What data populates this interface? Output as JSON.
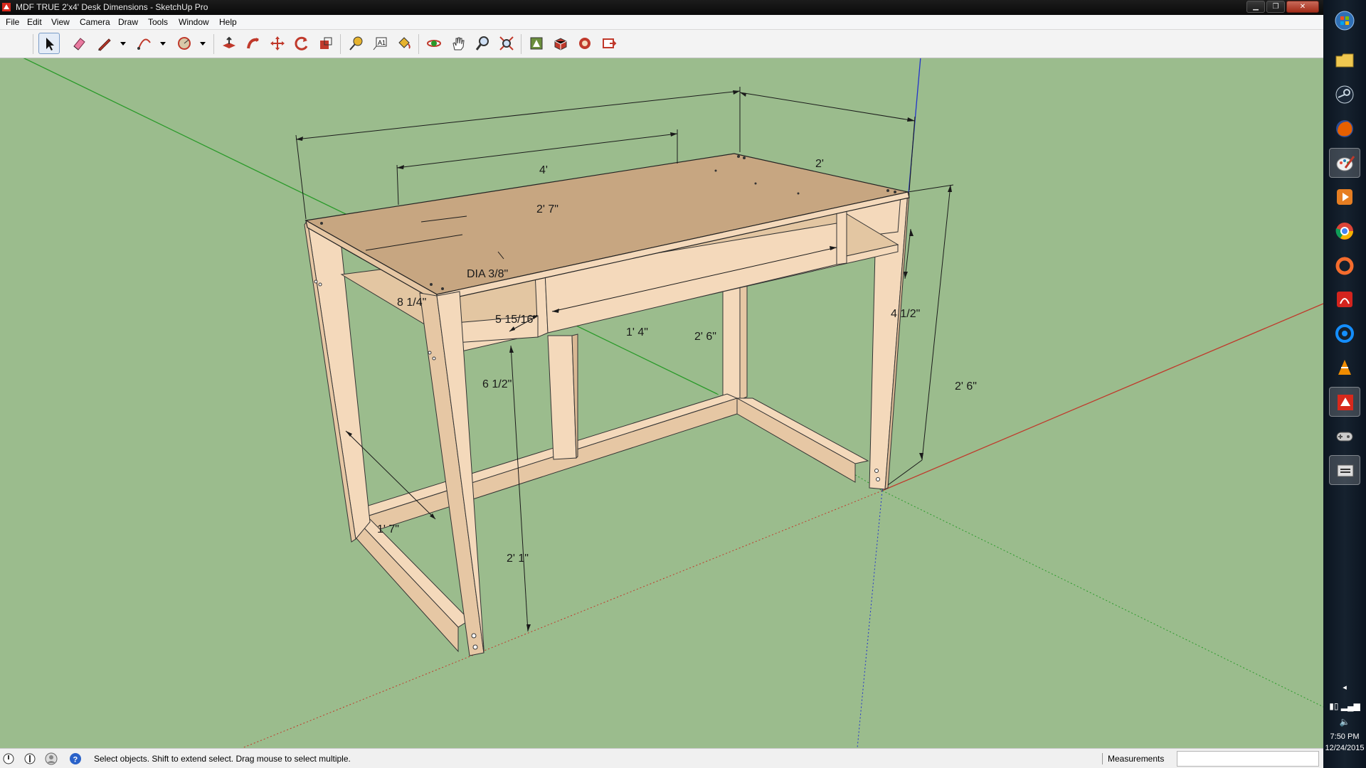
{
  "window": {
    "title": "MDF TRUE 2'x4' Desk Dimensions - SketchUp Pro",
    "minimize_label": "▁",
    "restore_label": "❐",
    "close_label": "✕"
  },
  "menu": [
    "File",
    "Edit",
    "View",
    "Camera",
    "Draw",
    "Tools",
    "Window",
    "Help"
  ],
  "toolbar": {
    "tools": [
      "select-tool",
      "eraser-tool",
      "pencil-line-tool",
      "arc-tool",
      "circle-tool",
      "push-pull-tool",
      "follow-me-tool",
      "move-tool",
      "rotate-tool",
      "scale-tool",
      "tape-measure-tool",
      "text-tool",
      "paint-bucket-tool",
      "orbit-tool",
      "pan-tool",
      "zoom-tool",
      "zoom-extents-tool",
      "3d-warehouse-tool",
      "extension-warehouse-tool",
      "layout-tool",
      "send-to-layout-tool"
    ],
    "active_tool": "select-tool"
  },
  "dimensions": {
    "width_4ft": "4'",
    "depth_2ft": "2'",
    "top_2ft7": "2' 7\"",
    "hole_dia": "DIA 3/8\"",
    "edge_8_1_4": "8 1/4\"",
    "edge_5_15_16": "5 15/16\"",
    "shelf_1ft4": "1' 4\"",
    "shelf_2ft6": "2' 6\"",
    "side_4_1_2": "4 1/2\"",
    "height_2ft6": "2' 6\"",
    "cubby_6_1_2": "6 1/2\"",
    "leg_1ft7": "1' 7\"",
    "leg_2ft1": "2' 1\""
  },
  "colors": {
    "ground": "#9bbc8d",
    "desktop": "#c7a681",
    "wood": "#f4d9bb",
    "axis_red": "#c0392b",
    "axis_green": "#2a9a2a",
    "axis_blue": "#2233cc"
  },
  "status": {
    "hint": "Select objects. Shift to extend select. Drag mouse to select multiple.",
    "measurements_label": "Measurements",
    "measurements_value": ""
  },
  "taskbar": {
    "apps": [
      "start-orb",
      "file-explorer",
      "steam",
      "firefox",
      "paint",
      "media-player",
      "chrome",
      "origin",
      "adobe-reader",
      "battlenet",
      "vlc",
      "sketchup",
      "game-controller",
      "network-manager"
    ],
    "time": "7:50 PM",
    "date": "12/24/2015",
    "show_hidden_label": "◂"
  }
}
